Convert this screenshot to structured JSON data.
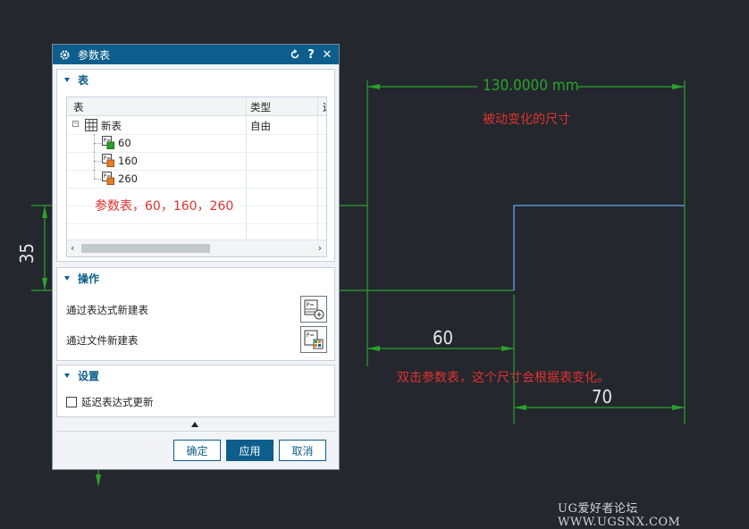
{
  "dialog": {
    "title": "参数表",
    "reset_icon": "reset-icon",
    "help_label": "?",
    "close_label": "✕"
  },
  "table_group": {
    "title": "表",
    "columns": [
      "表",
      "类型",
      "运"
    ],
    "root": {
      "name": "新表",
      "type": "自由"
    },
    "children": [
      "60",
      "160",
      "260"
    ],
    "scroll_left": "‹",
    "scroll_right": "›"
  },
  "operation_group": {
    "title": "操作",
    "actions": [
      "通过表达式新建表",
      "通过文件新建表"
    ]
  },
  "settings_group": {
    "title": "设置",
    "checkbox_label": "延迟表达式更新",
    "checked": false
  },
  "buttons": {
    "ok": "确定",
    "apply": "应用",
    "cancel": "取消"
  },
  "annotations": {
    "param_values": "参数表，60，160，260",
    "passive_dim": "被动变化的尺寸",
    "double_click_hint": "双击参数表，这个尺寸会根据表变化。"
  },
  "dimensions": {
    "width_total": "130.0000 mm",
    "width_60": "60",
    "width_70": "70",
    "height_35": "35"
  },
  "watermark": "UG爱好者论坛 WWW.UGSNX.COM",
  "colors": {
    "accent": "#0d5e8c",
    "dim_green": "#2ea62e",
    "red": "#e0322e",
    "profile_blue": "#5a8fd0"
  }
}
